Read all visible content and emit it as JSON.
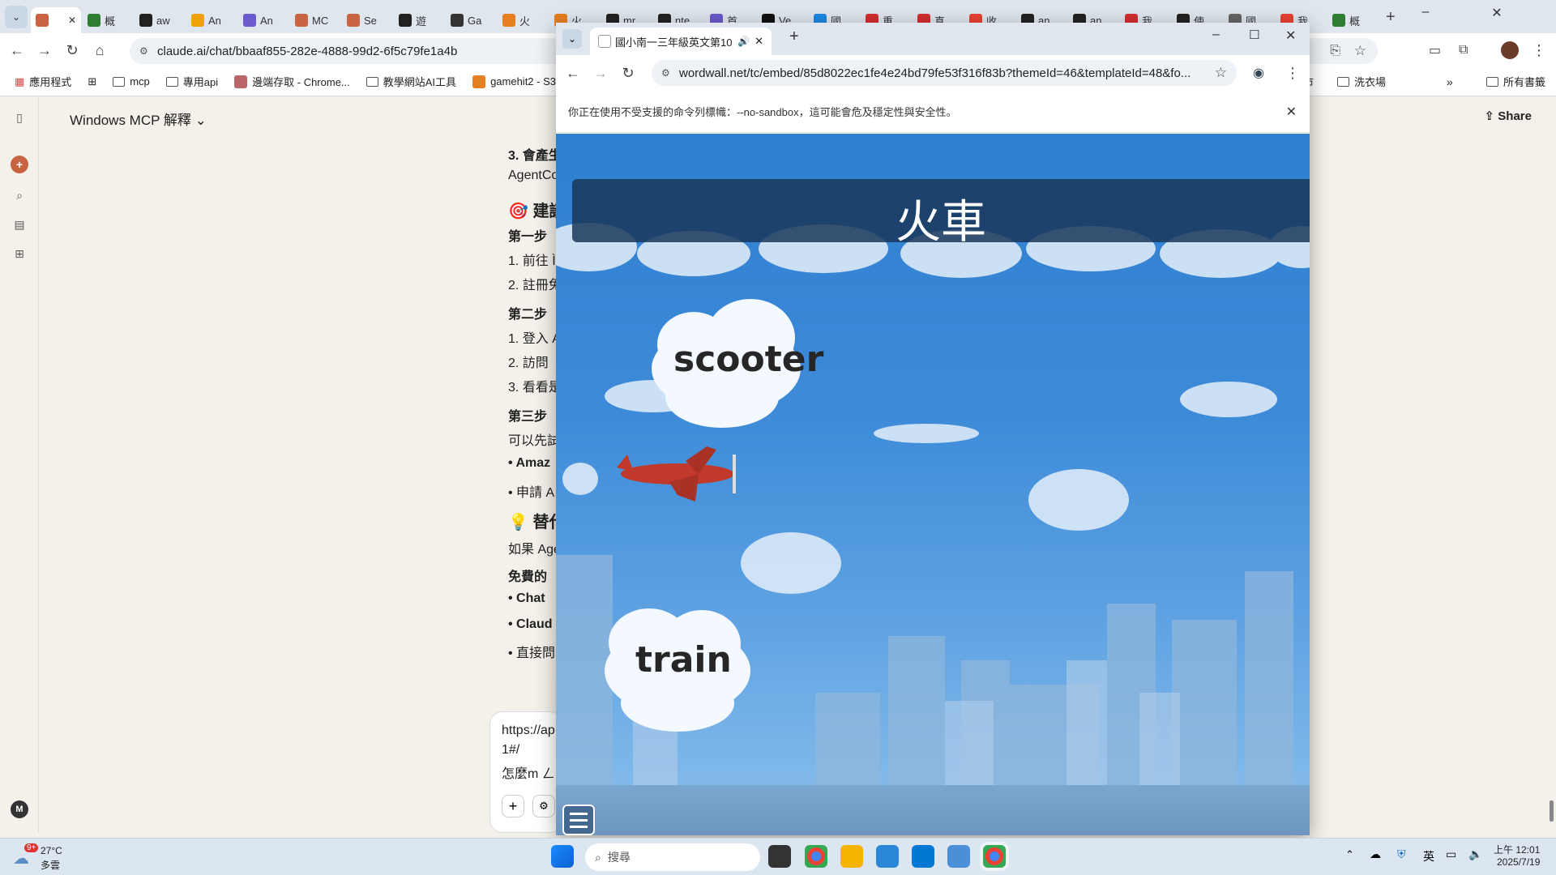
{
  "main_browser": {
    "tabs": [
      {
        "label": "",
        "active": true
      },
      {
        "label": "概"
      },
      {
        "label": "aw"
      },
      {
        "label": "An"
      },
      {
        "label": "An"
      },
      {
        "label": "MC"
      },
      {
        "label": "Se"
      },
      {
        "label": "遊"
      },
      {
        "label": "Ga"
      },
      {
        "label": "火"
      },
      {
        "label": "火"
      },
      {
        "label": "mr"
      },
      {
        "label": "nte"
      },
      {
        "label": "首"
      },
      {
        "label": "Ve"
      },
      {
        "label": "國"
      },
      {
        "label": "重"
      },
      {
        "label": "真"
      },
      {
        "label": "收"
      },
      {
        "label": "an"
      },
      {
        "label": "an"
      },
      {
        "label": "我"
      },
      {
        "label": "使"
      },
      {
        "label": "國"
      },
      {
        "label": "我"
      },
      {
        "label": "概"
      }
    ],
    "url": "claude.ai/chat/bbaaf855-282e-4888-99d2-6f5c79fe1a4b",
    "bookmarks": [
      "應用程式",
      "mcp",
      "專用api",
      "邊端存取 - Chrome...",
      "教學網站AI工具",
      "gamehit2 - S3"
    ],
    "bookmarks_right": [
      "市",
      "洗衣場",
      "所有書籤"
    ]
  },
  "claude": {
    "chat_title": "Windows MCP 解釋",
    "share_label": "Share",
    "avatar_letter": "M",
    "lines": [
      {
        "text": "3. 會產生",
        "style": "b"
      },
      {
        "text": "AgentCo",
        "style": ""
      },
      {
        "text": "🎯 建議",
        "style": "h"
      },
      {
        "text": "第一步",
        "style": "b"
      },
      {
        "text": "1. 前往 Ì",
        "style": ""
      },
      {
        "text": "2. 註冊免",
        "style": ""
      },
      {
        "text": "第二步",
        "style": "b"
      },
      {
        "text": "1. 登入 A",
        "style": ""
      },
      {
        "text": "2. 訪問",
        "style": ""
      },
      {
        "text": "3. 看看是",
        "style": ""
      },
      {
        "text": "第三步",
        "style": "b"
      },
      {
        "text": "可以先試",
        "style": ""
      },
      {
        "text": "• Amaz",
        "style": "b"
      },
      {
        "text": "• 申請 A",
        "style": ""
      },
      {
        "text": "💡 替代",
        "style": "h"
      },
      {
        "text": "如果 Age",
        "style": ""
      },
      {
        "text": "免費的",
        "style": "b"
      },
      {
        "text": "• Chat",
        "style": "b"
      },
      {
        "text": "• Claud",
        "style": "b"
      },
      {
        "text": "• 直接問",
        "style": ""
      }
    ],
    "composer_lines": [
      "https://ap",
      "1#/",
      "怎麼m ㄥ"
    ]
  },
  "popup": {
    "tab_title": "國小南一三年級英文第10課",
    "url": "wordwall.net/tc/embed/85d8022ec1fe4e24bd79fe53f316f83b?themeId=46&templateId=48&fo...",
    "infobar": "你正在使用不受支援的命令列標幟：--no-sandbox，這可能會危及穩定性與安全性。",
    "game": {
      "prompt": "火車",
      "answers": [
        "scooter",
        "train"
      ]
    }
  },
  "taskbar": {
    "weather_temp": "27°C",
    "weather_desc": "多雲",
    "weather_badge": "9+",
    "search_placeholder": "搜尋",
    "ime": "英",
    "time": "上午 12:01",
    "date": "2025/7/19"
  }
}
